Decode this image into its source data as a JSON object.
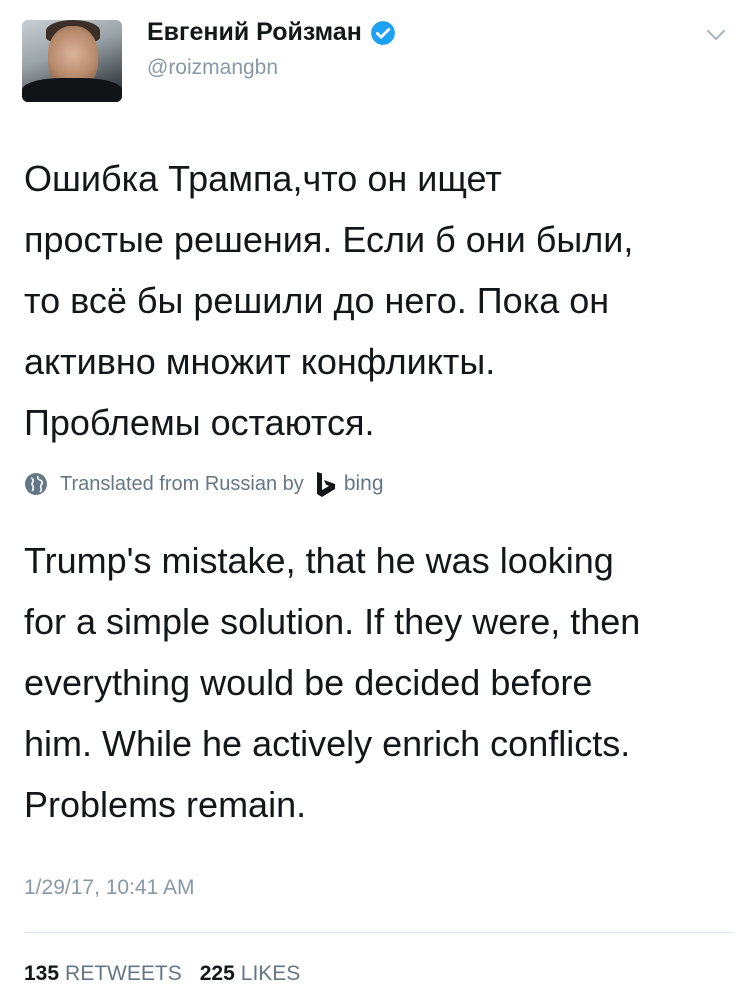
{
  "author": {
    "name": "Евгений Ройзман",
    "handle": "@roizmangbn",
    "verified": true,
    "avatar_icon": "profile-photo"
  },
  "tweet": {
    "original_text": "Ошибка Трампа,что он ищет простые решения. Если б они были, то всё бы решили до него. Пока он активно множит конфликты. Проблемы остаются.",
    "original_lines": [
      "Ошибка Трампа,что он ищет",
      "простые решения. Если б они были,",
      "то всё бы решили до него. Пока он",
      "активно множит конфликты.",
      "Проблемы остаются."
    ],
    "translation_notice": "Translated from Russian by",
    "translator": "bing",
    "translated_lines": [
      "Trump's mistake, that he was looking",
      "for a simple solution. If they were, then",
      "everything would be decided before",
      "him. While he actively enrich conflicts.",
      "Problems remain."
    ],
    "timestamp": "1/29/17, 10:41 AM"
  },
  "stats": {
    "retweets_count": "135",
    "retweets_label": "RETWEETS",
    "likes_count": "225",
    "likes_label": "LIKES"
  },
  "colors": {
    "text": "#14171a",
    "muted": "#8899a6",
    "verified_blue": "#1da1f2",
    "divider": "#e1e8ed"
  },
  "icons": {
    "verified": "verified-badge-icon",
    "menu": "chevron-down-icon",
    "globe": "globe-icon",
    "bing": "bing-logo-icon"
  }
}
